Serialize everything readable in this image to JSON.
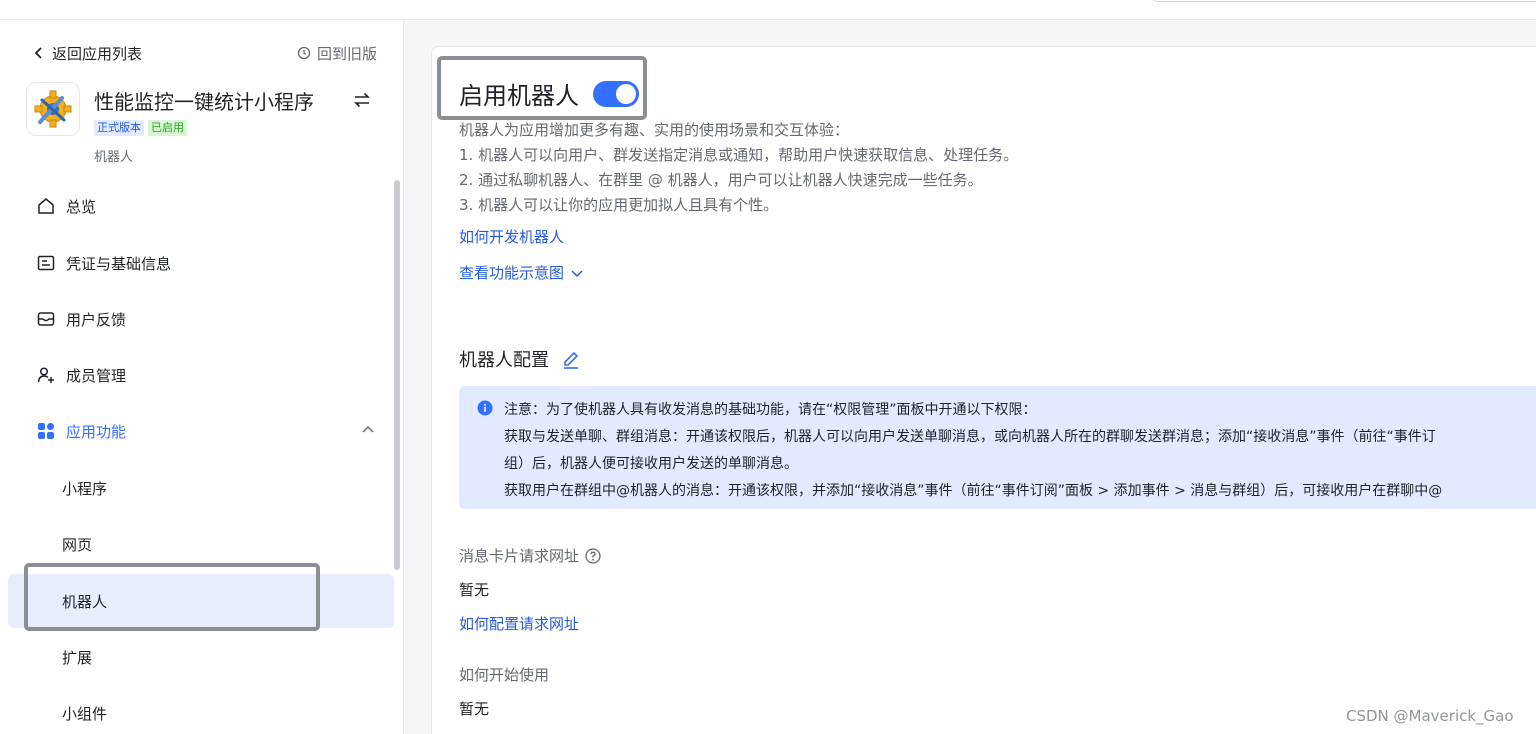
{
  "sidebar": {
    "back_label": "返回应用列表",
    "old_version_label": "回到旧版",
    "app_name": "性能监控一键统计小程序",
    "badge_release": "正式版本",
    "badge_enabled": "已启用",
    "app_type": "机器人",
    "nav": {
      "overview": "总览",
      "credentials": "凭证与基础信息",
      "feedback": "用户反馈",
      "members": "成员管理",
      "features": "应用功能",
      "miniprogram": "小程序",
      "webpage": "网页",
      "bot": "机器人",
      "extension": "扩展",
      "widget": "小组件"
    }
  },
  "main": {
    "enable_title": "启用机器人",
    "toggle_on": true,
    "desc": [
      "机器人为应用增加更多有趣、实用的使用场景和交互体验：",
      "1. 机器人可以向用户、群发送指定消息或通知，帮助用户快速获取信息、处理任务。",
      "2. 通过私聊机器人、在群里 @ 机器人，用户可以让机器人快速完成一些任务。",
      "3. 机器人可以让你的应用更加拟人且具有个性。"
    ],
    "how_develop_link": "如何开发机器人",
    "view_diagram_link": "查看功能示意图",
    "config_title": "机器人配置",
    "notice": {
      "line1": "注意：为了使机器人具有收发消息的基础功能，请在“权限管理”面板中开通以下权限：",
      "line2": "获取与发送单聊、群组消息：开通该权限后，机器人可以向用户发送单聊消息，或向机器人所在的群聊发送群消息；添加“接收消息”事件（前往“事件订",
      "line3": "组）后，机器人便可接收用户发送的单聊消息。",
      "line4": "获取用户在群组中@机器人的消息：开通该权限，并添加“接收消息”事件（前往“事件订阅”面板 > 添加事件 > 消息与群组）后，可接收用户在群聊中@"
    },
    "card_url_label": "消息卡片请求网址",
    "card_url_value": "暂无",
    "config_url_link": "如何配置请求网址",
    "how_to_use_label": "如何开始使用",
    "how_to_use_value": "暂无"
  },
  "watermark": "CSDN @Maverick_Gao",
  "colors": {
    "accent": "#3370ff",
    "link": "#245bdb",
    "notice_bg": "#e1eaff",
    "active_nav_bg": "#e8edfc",
    "highlight_border": "#8a8f96"
  }
}
